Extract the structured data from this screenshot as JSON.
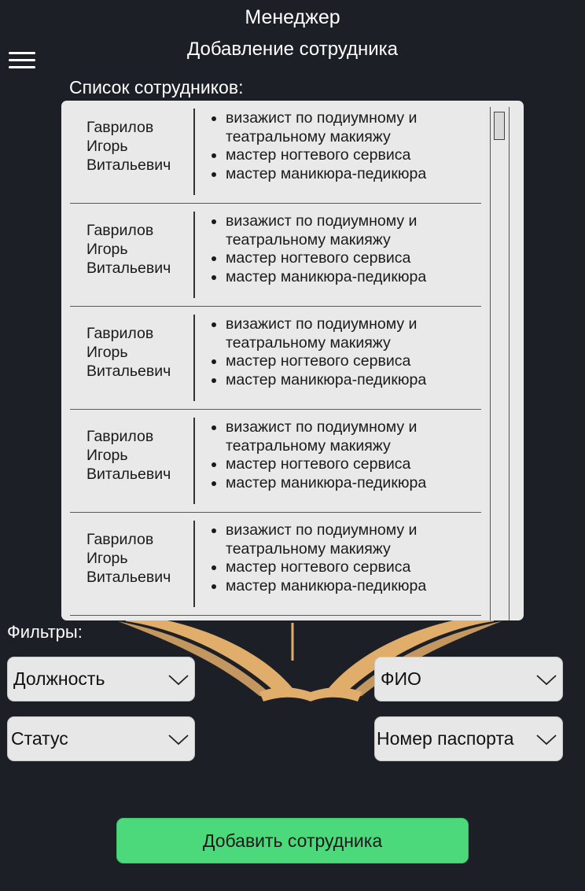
{
  "header": {
    "app_title": "Менеджер",
    "screen_title": "Добавление сотрудника"
  },
  "menu": {
    "icon": "hamburger-menu-icon"
  },
  "employees": {
    "label": "Список сотрудников:",
    "rows": [
      {
        "name": [
          "Гаврилов",
          "Игорь",
          "Витальевич"
        ],
        "skills": [
          "визажист по подиумному и театральному макияжу",
          "мастер ногтевого сервиса",
          "мастер маникюра-педикюра"
        ]
      },
      {
        "name": [
          "Гаврилов",
          "Игорь",
          "Витальевич"
        ],
        "skills": [
          "визажист по подиумному и театральному макияжу",
          "мастер ногтевого сервиса",
          "мастер маникюра-педикюра"
        ]
      },
      {
        "name": [
          "Гаврилов",
          "Игорь",
          "Витальевич"
        ],
        "skills": [
          "визажист по подиумному и театральному макияжу",
          "мастер ногтевого сервиса",
          "мастер маникюра-педикюра"
        ]
      },
      {
        "name": [
          "Гаврилов",
          "Игорь",
          "Витальевич"
        ],
        "skills": [
          "визажист по подиумному и театральному макияжу",
          "мастер ногтевого сервиса",
          "мастер маникюра-педикюра"
        ]
      },
      {
        "name": [
          "Гаврилов",
          "Игорь",
          "Витальевич"
        ],
        "skills": [
          "визажист по подиумному и театральному макияжу",
          "мастер ногтевого сервиса",
          "мастер маникюра-педикюра"
        ]
      }
    ]
  },
  "filters": {
    "label": "Фильтры:",
    "position": "Должность",
    "fio": "ФИО",
    "status": "Статус",
    "passport": "Номер паспорта"
  },
  "actions": {
    "add_employee": "Добавить сотрудника"
  },
  "colors": {
    "background": "#1c1f26",
    "panel": "#e9e9e9",
    "accent_green": "#4cd97b",
    "art_gold": "#e8b06a"
  }
}
